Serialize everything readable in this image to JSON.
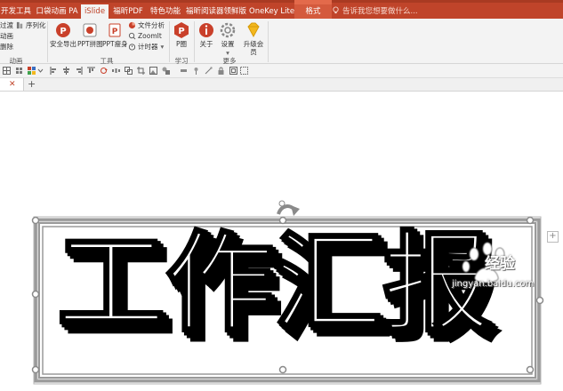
{
  "ribbon_tabs": [
    {
      "label": "开发工具"
    },
    {
      "label": "口袋动画 PA"
    },
    {
      "label": "iSlide"
    },
    {
      "label": "福昕PDF"
    },
    {
      "label": "特色功能"
    },
    {
      "label": "福昕阅读器领鲜版"
    },
    {
      "label": "OneKey Lite"
    },
    {
      "label": "格式"
    }
  ],
  "tell_me": "告诉我您想要做什么...",
  "groups": {
    "animation": {
      "label": "动画",
      "items": [
        "过渡",
        "序列化",
        "动画",
        "删除"
      ]
    },
    "tools": {
      "label": "工具",
      "buttons": [
        "安全导出",
        "PPT拼图",
        "PPT瘦身"
      ],
      "small": [
        "文件分析",
        "ZoomIt",
        "计时器"
      ]
    },
    "learn": {
      "label": "学习",
      "buttons": [
        "P圈"
      ]
    },
    "more": {
      "label": "更多",
      "buttons": [
        "关于",
        "设置",
        "升级会员"
      ]
    }
  },
  "slide": {
    "text": "工作汇报"
  },
  "watermark": {
    "brand": "经验",
    "url": "jingyan.baidu.com"
  },
  "colors": {
    "tabbar": "#c0442a",
    "ribbon_bg": "#f3f3f3",
    "selection": "#9a9a9a"
  }
}
